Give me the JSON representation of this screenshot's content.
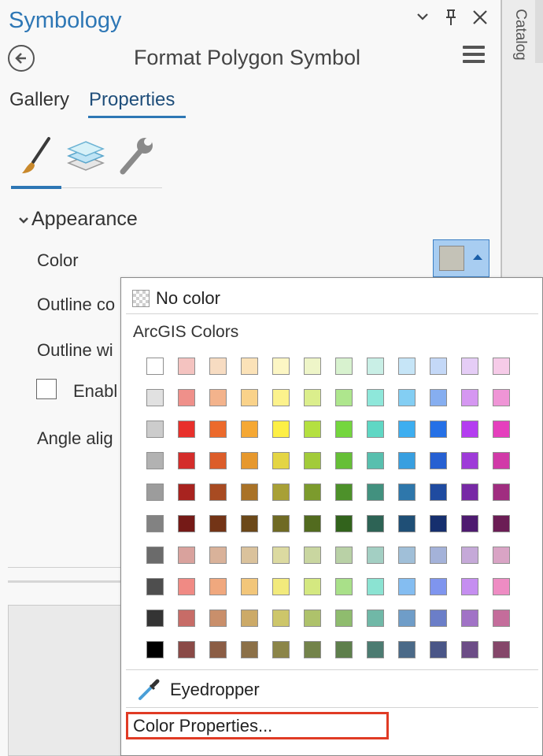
{
  "pane": {
    "title": "Symbology",
    "subtitle": "Format Polygon Symbol",
    "header_buttons": {
      "options": "⌄",
      "pin": "📌",
      "close": "✕"
    },
    "side_tab": "Catalog"
  },
  "tabs": [
    {
      "label": "Gallery",
      "active": false
    },
    {
      "label": "Properties",
      "active": true
    }
  ],
  "tool_icons": [
    "brush-icon",
    "layers-icon",
    "wrench-icon"
  ],
  "section": {
    "chevron": "⌄",
    "title": "Appearance"
  },
  "rows": {
    "color": "Color",
    "outline_color": "Outline co",
    "outline_width": "Outline wi",
    "enable": "Enabl",
    "angle": "Angle alig"
  },
  "current_color": "#c4c2b7",
  "dropdown": {
    "no_color": "No color",
    "group_label": "ArcGIS Colors",
    "eyedropper": "Eyedropper",
    "color_properties": "Color Properties...",
    "highlight_color": "#e03b25",
    "colors": [
      [
        "#ffffff",
        "#f4c3c0",
        "#f7dcc2",
        "#fbe2b8",
        "#fcf6c4",
        "#eef5c8",
        "#d8f2cf",
        "#c9efe6",
        "#c6e5f7",
        "#c4d8f7",
        "#e5cdf6",
        "#f6cbe8"
      ],
      [
        "#e1e1e1",
        "#ef908a",
        "#f3b38c",
        "#f9d28a",
        "#fcf28c",
        "#dbee8c",
        "#aee68d",
        "#8ee7da",
        "#83cef3",
        "#86aef0",
        "#d597f1",
        "#ef95d6"
      ],
      [
        "#cccccc",
        "#e8302b",
        "#ec6a2c",
        "#f5a834",
        "#fdef45",
        "#b4e040",
        "#74d63e",
        "#5fd7c4",
        "#3daef0",
        "#2570e6",
        "#b43df0",
        "#e53fbd"
      ],
      [
        "#b2b2b2",
        "#d42d2b",
        "#dc5d2a",
        "#e6982e",
        "#e4d544",
        "#a2cb3a",
        "#66bf37",
        "#58bfae",
        "#389fe0",
        "#2660d2",
        "#9e3bd8",
        "#d13aa8"
      ],
      [
        "#9c9c9c",
        "#a8231f",
        "#a84b22",
        "#a97227",
        "#a8a036",
        "#7c9b2d",
        "#4d912a",
        "#42917f",
        "#2e77ab",
        "#1f4ba0",
        "#7729a5",
        "#a02d80"
      ],
      [
        "#828282",
        "#751a17",
        "#733416",
        "#6b4819",
        "#6f6a24",
        "#526b1f",
        "#32631c",
        "#2d6355",
        "#1f4f76",
        "#162f6e",
        "#4e1b70",
        "#6b1d55"
      ],
      [
        "#6b6b6b",
        "#d9a29d",
        "#d9b29a",
        "#dac29c",
        "#dcdaa1",
        "#c9d6a0",
        "#b9d1a6",
        "#a3cfc3",
        "#a0bfd8",
        "#a4b2d9",
        "#c5a9d8",
        "#d9a4c5"
      ],
      [
        "#4e4e4e",
        "#f08a84",
        "#f0a87e",
        "#f2c67a",
        "#f2ea7c",
        "#d4e880",
        "#a9e089",
        "#8be3d2",
        "#84bdf1",
        "#7f95ee",
        "#c58ef0",
        "#ee8cc3"
      ],
      [
        "#343434",
        "#c76c67",
        "#c98f6b",
        "#ccaa68",
        "#cdc66a",
        "#aec26b",
        "#8fbc6e",
        "#70b8a7",
        "#6f9dc8",
        "#6b7ec8",
        "#a173c6",
        "#c46d9b"
      ],
      [
        "#000000",
        "#8a4a47",
        "#8b5d45",
        "#8b7048",
        "#8b8549",
        "#73834a",
        "#5e7f4c",
        "#4c7b71",
        "#4b6a88",
        "#4a5687",
        "#6c4d86",
        "#85476a"
      ]
    ]
  }
}
